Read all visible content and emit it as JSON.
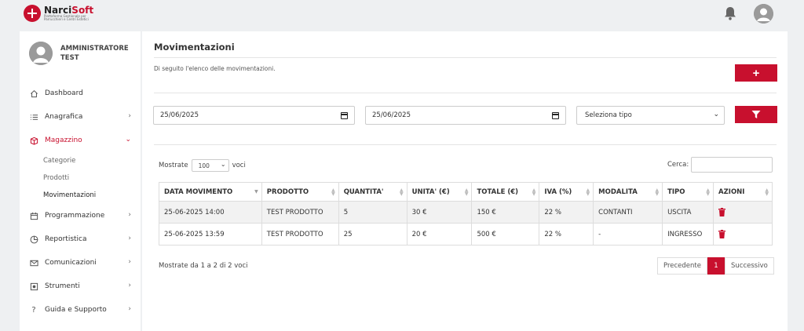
{
  "brand": {
    "name_part1": "Narci",
    "name_part2": "Soft",
    "tagline": "Piattaforma Gestionale per Parrucchieri e Centri Estetici"
  },
  "user": {
    "name": "AMMINISTRATORE TEST"
  },
  "sidebar": {
    "items": [
      {
        "label": "Dashboard",
        "icon": "home-icon",
        "has_chevron": false
      },
      {
        "label": "Anagrafica",
        "icon": "list-icon",
        "has_chevron": true
      },
      {
        "label": "Magazzino",
        "icon": "box-icon",
        "has_chevron": true,
        "active": true,
        "subitems": [
          "Categorie",
          "Prodotti",
          "Movimentazioni"
        ]
      },
      {
        "label": "Programmazione",
        "icon": "calendar-icon",
        "has_chevron": true
      },
      {
        "label": "Reportistica",
        "icon": "pie-chart-icon",
        "has_chevron": true
      },
      {
        "label": "Comunicazioni",
        "icon": "envelope-icon",
        "has_chevron": true
      },
      {
        "label": "Strumenti",
        "icon": "tools-icon",
        "has_chevron": true
      },
      {
        "label": "Guida e Supporto",
        "icon": "question-icon",
        "has_chevron": true
      }
    ]
  },
  "main": {
    "title": "Movimentazioni",
    "description": "Di seguito l'elenco delle movimentazioni.",
    "add_label": "+",
    "filters": {
      "date_from": "25/06/2025",
      "date_to": "25/06/2025",
      "type_select": "Seleziona tipo"
    },
    "table_controls": {
      "show_label": "Mostrate",
      "page_length": "100",
      "entries_label": "voci",
      "search_label": "Cerca:"
    },
    "table": {
      "headers": [
        "DATA MOVIMENTO",
        "PRODOTTO",
        "QUANTITA'",
        "UNITA' (€)",
        "TOTALE (€)",
        "IVA (%)",
        "MODALITA",
        "TIPO",
        "AZIONI"
      ],
      "rows": [
        [
          "25-06-2025 14:00",
          "TEST PRODOTTO",
          "5",
          "30 €",
          "150 €",
          "22 %",
          "CONTANTI",
          "USCITA"
        ],
        [
          "25-06-2025 13:59",
          "TEST PRODOTTO",
          "25",
          "20 €",
          "500 €",
          "22 %",
          "-",
          "INGRESSO"
        ]
      ]
    },
    "info": "Mostrate da 1 a 2 di 2 voci",
    "pagination": {
      "prev": "Precedente",
      "current": "1",
      "next": "Successivo"
    }
  },
  "colors": {
    "accent": "#c8102e",
    "background": "#eef0f2",
    "panel": "#ffffff"
  }
}
